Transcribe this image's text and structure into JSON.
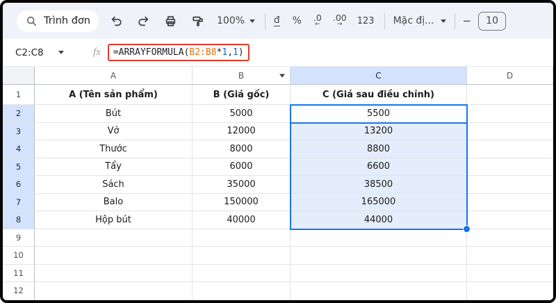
{
  "toolbar": {
    "menu_search": "Trình đơn",
    "zoom": "100%",
    "currency": "đ",
    "percent": "%",
    "decrease_decimal": ".0",
    "decrease_decimal_arrow": "←",
    "increase_decimal": ".00",
    "increase_decimal_arrow": "→",
    "number_format": "123",
    "font_name": "Mặc đị...",
    "minus": "−",
    "font_size": "10"
  },
  "formula_bar": {
    "name_box": "C2:C8",
    "fx": "fx",
    "formula": {
      "prefix": "=ARRAYFORMULA(",
      "range": "B2:B8",
      "operator": "*",
      "num1": "1",
      "comma": ",",
      "num2": "1",
      "close": ")"
    }
  },
  "grid": {
    "column_headers": [
      "A",
      "B",
      "C",
      "D"
    ],
    "dropdown_column": "B",
    "selection": {
      "column": "C",
      "row_start": 2,
      "row_end": 8,
      "active_cell": "C2"
    },
    "row_headers": [
      "1",
      "2",
      "3",
      "4",
      "5",
      "6",
      "7",
      "8",
      "9",
      "10",
      "11",
      "12"
    ],
    "rows": [
      [
        "A (Tên sản phẩm)",
        "B (Giá gốc)",
        "C (Giá sau điều chỉnh)",
        ""
      ],
      [
        "Bút",
        "5000",
        "5500",
        ""
      ],
      [
        "Vở",
        "12000",
        "13200",
        ""
      ],
      [
        "Thước",
        "8000",
        "8800",
        ""
      ],
      [
        "Tẩy",
        "6000",
        "6600",
        ""
      ],
      [
        "Sách",
        "35000",
        "38500",
        ""
      ],
      [
        "Balo",
        "150000",
        "165000",
        ""
      ],
      [
        "Hộp bút",
        "40000",
        "44000",
        ""
      ],
      [
        "",
        "",
        "",
        ""
      ],
      [
        "",
        "",
        "",
        ""
      ],
      [
        "",
        "",
        "",
        ""
      ],
      [
        "",
        "",
        "",
        ""
      ]
    ]
  },
  "colors": {
    "accent_blue": "#1a73e8",
    "selection_fill": "#e4edfb",
    "selected_header": "#d3e3fd",
    "formula_range_orange": "#e8710a",
    "formula_number_blue": "#1967d2",
    "highlight_red": "#e5382b",
    "toolbar_bg": "#eff3f9"
  }
}
